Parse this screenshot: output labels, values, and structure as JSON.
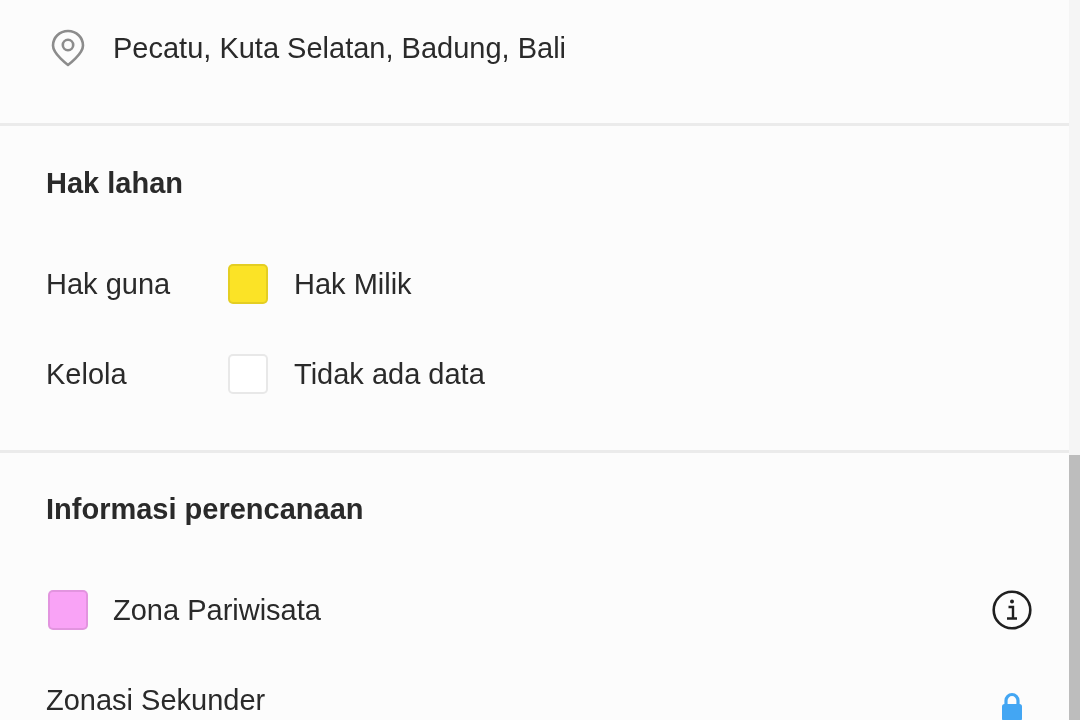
{
  "location": {
    "text": "Pecatu, Kuta Selatan, Badung, Bali"
  },
  "land_rights": {
    "title": "Hak lahan",
    "rows": [
      {
        "label": "Hak guna",
        "value": "Hak Milik",
        "color": "#fbe326"
      },
      {
        "label": "Kelola",
        "value": "Tidak ada data",
        "color": "#ffffff"
      }
    ]
  },
  "planning": {
    "title": "Informasi perencanaan",
    "zones": [
      {
        "name": "Zona Pariwisata",
        "color": "#f9a3f6"
      }
    ],
    "secondary_zoning": {
      "title": "Zonasi Sekunder",
      "locked": true
    }
  }
}
